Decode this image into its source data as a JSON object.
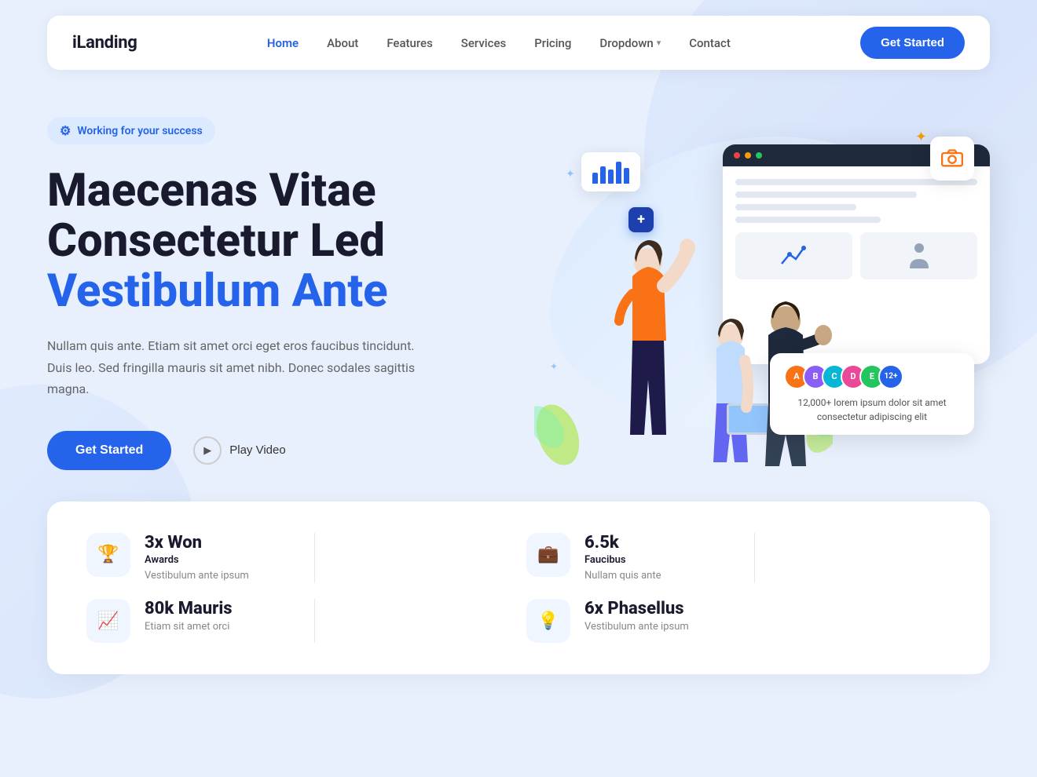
{
  "brand": {
    "name": "iLanding"
  },
  "navbar": {
    "links": [
      {
        "label": "Home",
        "active": true
      },
      {
        "label": "About",
        "active": false
      },
      {
        "label": "Features",
        "active": false
      },
      {
        "label": "Services",
        "active": false
      },
      {
        "label": "Pricing",
        "active": false
      },
      {
        "label": "Dropdown",
        "active": false,
        "has_dropdown": true
      },
      {
        "label": "Contact",
        "active": false
      }
    ],
    "cta_label": "Get Started"
  },
  "hero": {
    "badge_icon": "⚙",
    "badge_text": "Working for your success",
    "title_line1": "Maecenas Vitae",
    "title_line2": "Consectetur Led",
    "title_line3": "Vestibulum Ante",
    "description": "Nullam quis ante. Etiam sit amet orci eget eros faucibus tincidunt. Duis leo. Sed fringilla mauris sit amet nibh. Donec sodales sagittis magna.",
    "cta_label": "Get Started",
    "play_label": "Play Video"
  },
  "social_proof": {
    "count_text": "12,000+",
    "desc": "lorem ipsum dolor sit amet consectetur adipiscing elit"
  },
  "stats": [
    {
      "icon": "🏆",
      "title": "3x Won",
      "subtitle": "Awards",
      "desc": "Vestibulum ante ipsum"
    },
    {
      "icon": "💼",
      "title": "6.5k",
      "subtitle": "Faucibus",
      "desc": "Nullam quis ante"
    },
    {
      "icon": "📈",
      "title": "80k Mauris",
      "subtitle": "",
      "desc": "Etiam sit amet orci"
    },
    {
      "icon": "💡",
      "title": "6x Phasellus",
      "subtitle": "",
      "desc": "Vestibulum ante ipsum"
    }
  ]
}
